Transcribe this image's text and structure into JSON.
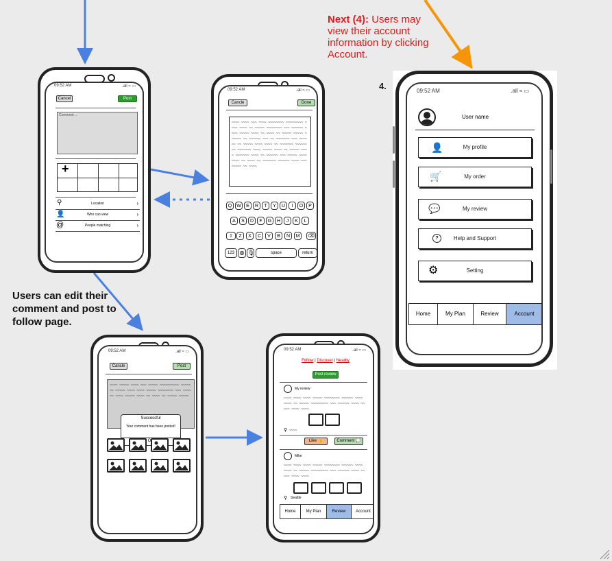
{
  "annotations": {
    "next_label": "Next (4):",
    "next_text": "Users may view their account information by clicking Account.",
    "step_number": "4.",
    "edit_caption": "Users can edit their comment and post to follow page."
  },
  "colors": {
    "arrow_blue": "#4a80e0",
    "arrow_orange": "#f5960a",
    "annot_red": "#e01919",
    "post_green": "#2a9d2a",
    "account_tab": "#9fbbe8"
  },
  "status": {
    "time": "09:52 AM",
    "signal": ".all ≈ ▭"
  },
  "screen1": {
    "cancel": "Cancel",
    "post": "Post",
    "comment_placeholder": "Comment ...",
    "plus": "+",
    "options": [
      {
        "icon": "location-pin-icon",
        "label": "Location"
      },
      {
        "icon": "person-icon",
        "label": "Who can view"
      },
      {
        "icon": "at-icon",
        "label": "People matching"
      }
    ]
  },
  "screen2": {
    "cancel": "Cancle",
    "done": "Done",
    "row1": [
      "Q",
      "W",
      "E",
      "R",
      "T",
      "Y",
      "U",
      "I",
      "O",
      "P"
    ],
    "row2": [
      "A",
      "S",
      "D",
      "F",
      "G",
      "H",
      "J",
      "K",
      "L"
    ],
    "row3": [
      "Z",
      "X",
      "C",
      "V",
      "B",
      "N",
      "M"
    ],
    "num": "123",
    "space": "space",
    "ret": "return"
  },
  "screen3": {
    "cancel": "Cancle",
    "post": "Post",
    "dialog_title": "Successful",
    "dialog_body": "Your comment has been posted!",
    "ok": "OK"
  },
  "screen4": {
    "tabs": [
      "Follow",
      "Discover",
      "Nearby"
    ],
    "post_review": "Post review",
    "my_review": "My review",
    "like": "Like",
    "comment": "Comment",
    "user2": "Mike",
    "location2": "Seattle",
    "bottom_tabs": [
      "Home",
      "My Plan",
      "Review",
      "Account"
    ]
  },
  "screen5": {
    "user_name": "User name",
    "menu": [
      {
        "icon": "person-icon",
        "label": "My profile"
      },
      {
        "icon": "cart-icon",
        "label": "My order"
      },
      {
        "icon": "speech-bubble-icon",
        "label": "My review"
      },
      {
        "icon": "help-icon",
        "label": "Help and Support"
      },
      {
        "icon": "gear-icon",
        "label": "Setting"
      }
    ],
    "bottom_tabs": [
      "Home",
      "My Plan",
      "Review",
      "Account"
    ]
  }
}
